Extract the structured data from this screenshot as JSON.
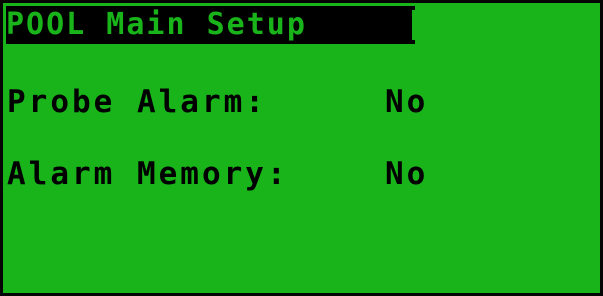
{
  "screen": {
    "title": "POOL Main Setup",
    "background_color": "#18b41a",
    "text_color": "#000000"
  },
  "fields": [
    {
      "label": "Probe Alarm:",
      "value": "No"
    },
    {
      "label": "Alarm Memory:",
      "value": "No"
    }
  ]
}
